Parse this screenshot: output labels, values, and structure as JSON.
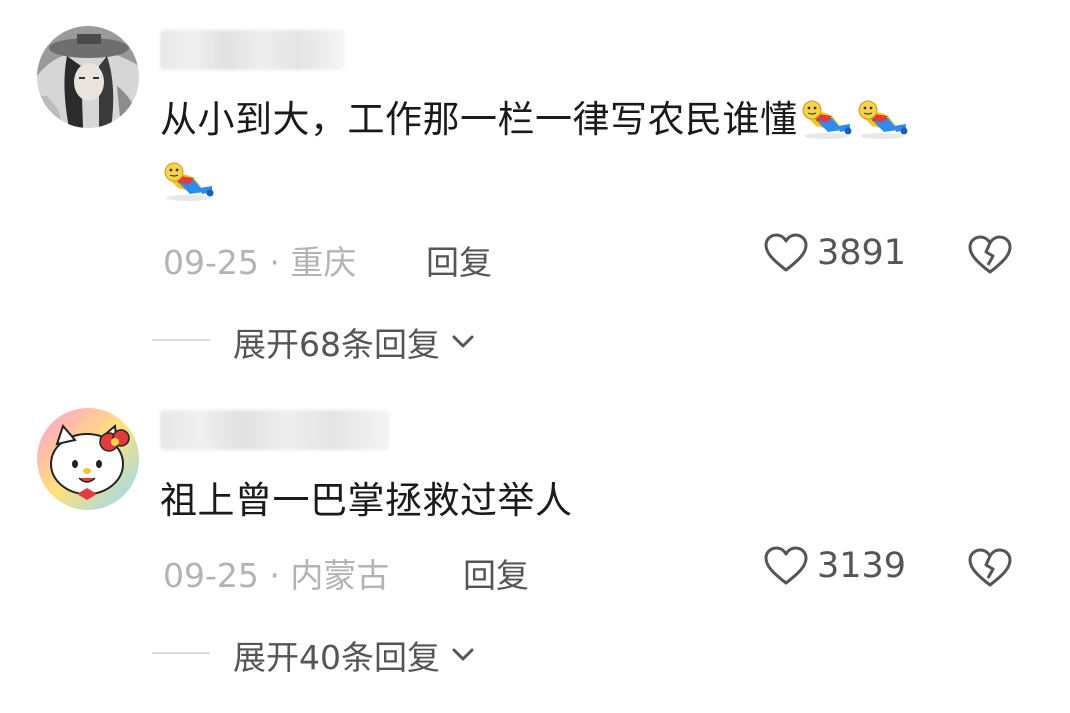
{
  "comments": [
    {
      "text": "从小到大，工作那一栏一律写农民谁懂",
      "emojis": [
        "doge-lying-icon",
        "doge-lying-icon",
        "doge-lying-icon"
      ],
      "date": "09-25",
      "sep": "·",
      "location": "重庆",
      "reply_label": "回复",
      "likes": "3891",
      "expand_label": "展开68条回复"
    },
    {
      "text": "祖上曾一巴掌拯救过举人",
      "date": "09-25",
      "sep": "·",
      "location": "内蒙古",
      "reply_label": "回复",
      "likes": "3139",
      "expand_label": "展开40条回复"
    }
  ],
  "colors": {
    "text": "#1a1a1a",
    "meta": "#b3b3b3",
    "action": "#555555"
  }
}
